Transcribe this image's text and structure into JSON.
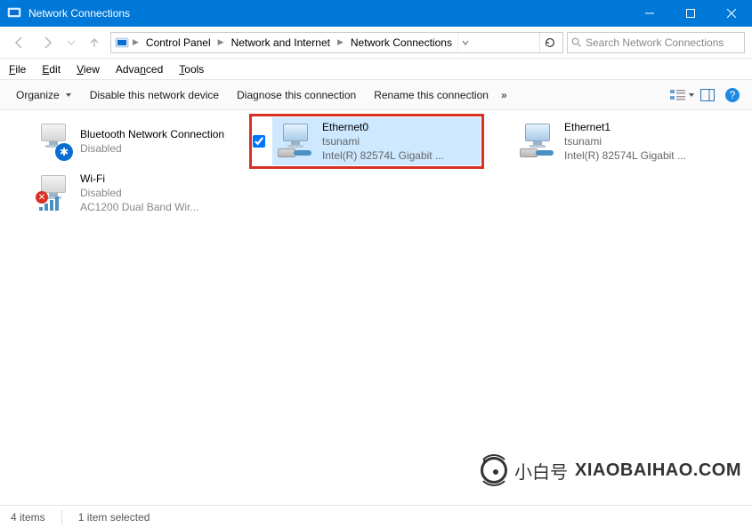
{
  "window": {
    "title": "Network Connections"
  },
  "breadcrumb": {
    "items": [
      "Control Panel",
      "Network and Internet",
      "Network Connections"
    ]
  },
  "search": {
    "placeholder": "Search Network Connections"
  },
  "menu": {
    "file": "File",
    "edit": "Edit",
    "view": "View",
    "advanced": "Advanced",
    "tools": "Tools"
  },
  "toolbar": {
    "organize": "Organize",
    "disable": "Disable this network device",
    "diagnose": "Diagnose this connection",
    "rename": "Rename this connection"
  },
  "connections": [
    {
      "name": "Bluetooth Network Connection",
      "status": "Disabled",
      "device": "",
      "icon": "bluetooth",
      "selected": false,
      "disabled": true
    },
    {
      "name": "Ethernet0",
      "status": "tsunami",
      "device": "Intel(R) 82574L Gigabit ...",
      "icon": "ethernet",
      "selected": true,
      "disabled": false
    },
    {
      "name": "Ethernet1",
      "status": "tsunami",
      "device": "Intel(R) 82574L Gigabit ...",
      "icon": "ethernet",
      "selected": false,
      "disabled": false
    },
    {
      "name": "Wi-Fi",
      "status": "Disabled",
      "device": "AC1200  Dual Band Wir...",
      "icon": "wifi",
      "selected": false,
      "disabled": true
    }
  ],
  "status": {
    "count": "4 items",
    "selected": "1 item selected"
  },
  "brand": {
    "zh": "小白号",
    "en": "XIAOBAIHAO.COM"
  }
}
